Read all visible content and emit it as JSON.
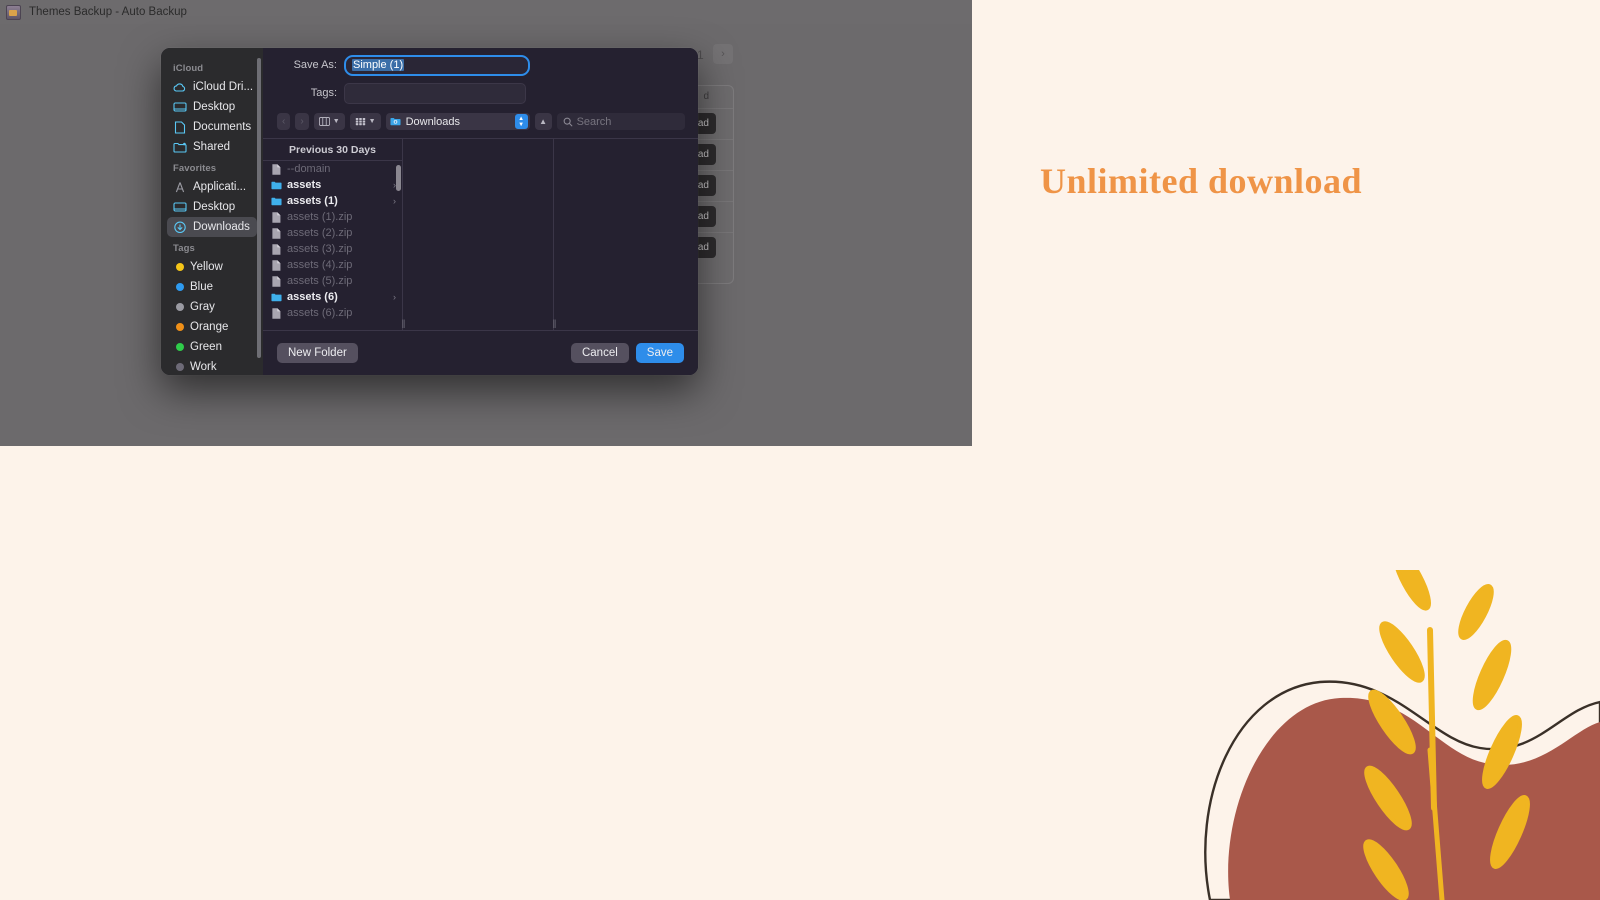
{
  "window": {
    "title": "Themes Backup - Auto Backup",
    "icon": "app-icon"
  },
  "page": {
    "headline": "Unlimited download",
    "headline_color": "#ef9447",
    "background_color": "#fdf3ea",
    "pagination": {
      "current": "1",
      "next_icon": "chevron-right-icon"
    },
    "download_buttons": [
      "ad",
      "ad",
      "ad",
      "ad",
      "ad"
    ],
    "card_header": "d",
    "decoration": {
      "blob_color": "#a9584a",
      "leaf_color": "#f0b521",
      "outline_color": "#3a3028"
    }
  },
  "dialog": {
    "save_as": {
      "label": "Save As:",
      "value": "Simple (1)",
      "selected": true
    },
    "tags": {
      "label": "Tags:",
      "value": "",
      "placeholder": ""
    },
    "toolbar": {
      "back_icon": "chevron-left-icon",
      "forward_icon": "chevron-right-icon",
      "view_icon": "column-view-icon",
      "group_icon": "group-by-icon",
      "location_icon": "folder-downloads-icon",
      "location": "Downloads",
      "stepper_icon": "stepper-up-down-icon",
      "up_icon": "chevron-up-icon",
      "search_icon": "search-icon",
      "search_placeholder": "Search"
    },
    "sidebar": {
      "sections": [
        {
          "title": "iCloud",
          "items": [
            {
              "label": "iCloud Dri...",
              "icon": "icloud-icon",
              "color": "#5ac8f5",
              "selected": false
            },
            {
              "label": "Desktop",
              "icon": "desktop-icon",
              "color": "#5ac8f5",
              "selected": false
            },
            {
              "label": "Documents",
              "icon": "document-icon",
              "color": "#5ac8f5",
              "selected": false
            },
            {
              "label": "Shared",
              "icon": "shared-folder-icon",
              "color": "#5ac8f5",
              "selected": false
            }
          ]
        },
        {
          "title": "Favorites",
          "items": [
            {
              "label": "Applicati...",
              "icon": "applications-icon",
              "color": "#9a9aa2",
              "selected": false
            },
            {
              "label": "Desktop",
              "icon": "desktop-icon",
              "color": "#5ac8f5",
              "selected": false
            },
            {
              "label": "Downloads",
              "icon": "downloads-icon",
              "color": "#5ac8f5",
              "selected": true
            }
          ]
        },
        {
          "title": "Tags",
          "items": [
            {
              "label": "Yellow",
              "icon": "tag-dot-icon",
              "color": "#f5c518",
              "selected": false
            },
            {
              "label": "Blue",
              "icon": "tag-dot-icon",
              "color": "#2e9bf0",
              "selected": false
            },
            {
              "label": "Gray",
              "icon": "tag-dot-icon",
              "color": "#9a9aa2",
              "selected": false
            },
            {
              "label": "Orange",
              "icon": "tag-dot-icon",
              "color": "#f09018",
              "selected": false
            },
            {
              "label": "Green",
              "icon": "tag-dot-icon",
              "color": "#2fcc4a",
              "selected": false
            },
            {
              "label": "Work",
              "icon": "tag-dot-icon",
              "color": "#6d6a77",
              "selected": false
            }
          ]
        }
      ]
    },
    "file_list": {
      "header": "Previous 30 Days",
      "rows": [
        {
          "name": "--domain",
          "type": "file",
          "dim": true,
          "disclosure": false
        },
        {
          "name": "assets",
          "type": "folder",
          "dim": false,
          "disclosure": true
        },
        {
          "name": "assets (1)",
          "type": "folder",
          "dim": false,
          "disclosure": true
        },
        {
          "name": "assets (1).zip",
          "type": "file",
          "dim": true,
          "disclosure": false
        },
        {
          "name": "assets (2).zip",
          "type": "file",
          "dim": true,
          "disclosure": false
        },
        {
          "name": "assets (3).zip",
          "type": "file",
          "dim": true,
          "disclosure": false
        },
        {
          "name": "assets (4).zip",
          "type": "file",
          "dim": true,
          "disclosure": false
        },
        {
          "name": "assets (5).zip",
          "type": "file",
          "dim": true,
          "disclosure": false
        },
        {
          "name": "assets (6)",
          "type": "folder",
          "dim": false,
          "disclosure": true
        },
        {
          "name": "assets (6).zip",
          "type": "file",
          "dim": true,
          "disclosure": false
        }
      ]
    },
    "footer": {
      "new_folder": "New Folder",
      "cancel": "Cancel",
      "save": "Save"
    },
    "accent_color": "#2e8dea",
    "background_color": "#252130"
  }
}
